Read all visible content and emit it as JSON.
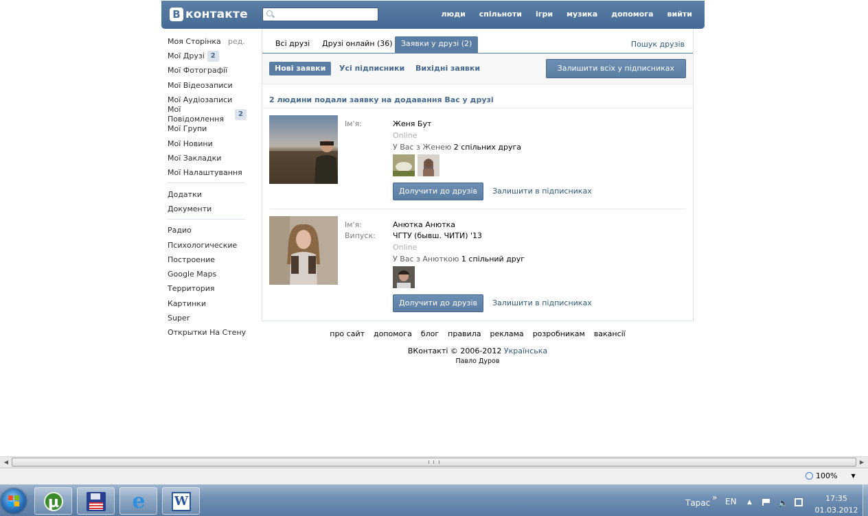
{
  "header": {
    "logo_letter": "B",
    "logo_text": "контакте",
    "search_placeholder": "",
    "nav": [
      "люди",
      "спільноти",
      "ігри",
      "музика",
      "допомога",
      "вийти"
    ]
  },
  "sidebar": {
    "items": [
      {
        "label": "Моя Сторінка",
        "edit": "ред."
      },
      {
        "label": "Мої Друзі",
        "badge": "2"
      },
      {
        "label": "Мої Фотографії"
      },
      {
        "label": "Мої Відеозаписи"
      },
      {
        "label": "Мої Аудіозаписи"
      },
      {
        "label": "Мої Повідомлення",
        "badge": "2"
      },
      {
        "label": "Мої Групи"
      },
      {
        "label": "Мої Новини"
      },
      {
        "label": "Мої Закладки"
      },
      {
        "label": "Мої Налаштування"
      }
    ],
    "apps": [
      "Додатки",
      "Документи"
    ],
    "bookmarks": [
      "Радио",
      "Психологические",
      "Построение",
      "Google Maps",
      "Территория",
      "Картинки",
      "Super",
      "Открытки На Стену"
    ]
  },
  "tabs": {
    "items": [
      "Всі друзі",
      "Друзі онлайн (36)",
      "Заявки у друзі (2)"
    ],
    "active": 2,
    "find_friends": "Пошук друзів"
  },
  "subtabs": {
    "items": [
      "Нові заявки",
      "Усі підписники",
      "Вихідні заявки"
    ],
    "active": 0,
    "keep_all_button": "Залишити всіх у підписниках"
  },
  "summary": "2 людини подали заявку на додавання Вас у друзі",
  "requests": [
    {
      "name_label": "Ім'я:",
      "name": "Женя Бут",
      "status": "Online",
      "mutual_prefix": "У Вас з Женею",
      "mutual_count": "2 спільних друга",
      "add_button": "Долучити до друзів",
      "keep_link": "Залишити в підписниках"
    },
    {
      "name_label": "Ім'я:",
      "name": "Анютка Анютка",
      "grad_label": "Випуск:",
      "grad": "ЧГТУ (бывш. ЧИТИ) '13",
      "status": "Online",
      "mutual_prefix": "У Вас з Анюткою",
      "mutual_count": "1 спільний друг",
      "add_button": "Долучити до друзів",
      "keep_link": "Залишити в підписниках"
    }
  ],
  "footer": {
    "links": [
      "про сайт",
      "допомога",
      "блог",
      "правила",
      "реклама",
      "розробникам",
      "вакансії"
    ],
    "copyright": "ВКонтакті © 2006-2012",
    "language": "Українська",
    "author": "Павло Дуров"
  },
  "browser": {
    "zoom": "100%"
  },
  "taskbar": {
    "user": "Тарас",
    "lang": "EN",
    "time": "17:35",
    "date": "01.03.2012"
  },
  "colors": {
    "header": "#4a6f99",
    "accent": "#597da3",
    "link": "#2b587a"
  }
}
